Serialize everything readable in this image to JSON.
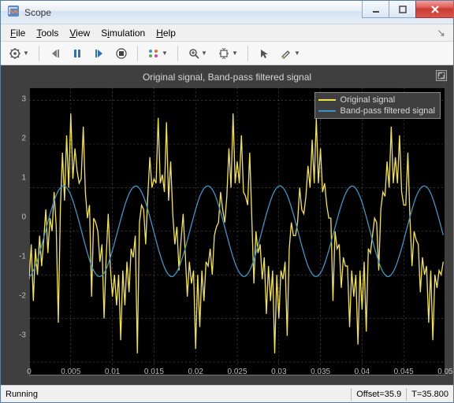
{
  "window": {
    "title": "Scope"
  },
  "menu": {
    "file": "File",
    "tools": "Tools",
    "view": "View",
    "simulation": "Simulation",
    "help": "Help"
  },
  "toolbar": {
    "settings": "Settings",
    "step_back": "Step back",
    "pause": "Pause",
    "step_fwd": "Step forward",
    "stop": "Stop",
    "triggers": "Triggers",
    "zoom": "Zoom",
    "autoscale": "Autoscale",
    "cursor": "Cursor measurements",
    "highlight": "Highlight"
  },
  "plot": {
    "title": "Original signal, Band-pass filtered signal",
    "legend": {
      "s1": "Original signal",
      "s2": "Band-pass filtered signal"
    },
    "yticks": [
      "-3",
      "-2",
      "-1",
      "0",
      "1",
      "2",
      "3"
    ],
    "xticks": [
      "0",
      "0.005",
      "0.01",
      "0.015",
      "0.02",
      "0.025",
      "0.03",
      "0.035",
      "0.04",
      "0.045",
      "0.05"
    ]
  },
  "status": {
    "state": "Running",
    "offset": "Offset=35.9",
    "t": "T=35.800"
  },
  "colors": {
    "s1": "#f2e24b",
    "s2": "#3c93c2",
    "grid": "#5a5a5a",
    "plotbg": "#000000"
  },
  "chart_data": {
    "type": "line",
    "title": "Original signal, Band-pass filtered signal",
    "xlabel": "",
    "ylabel": "",
    "xlim": [
      0,
      0.05
    ],
    "ylim": [
      -3.3,
      3.3
    ],
    "grid": true,
    "legend_position": "upper right",
    "series": [
      {
        "name": "Original signal",
        "color": "#f2e24b",
        "x_step": 0.00025,
        "values": [
          -1.1,
          -0.3,
          -1.6,
          -0.4,
          -1.0,
          -0.1,
          -0.8,
          -0.2,
          0.5,
          -0.5,
          0.3,
          0.0,
          0.9,
          0.1,
          -2.1,
          0.5,
          1.8,
          0.7,
          2.2,
          1.0,
          2.7,
          1.2,
          1.9,
          1.4,
          1.1,
          1.2,
          2.4,
          0.9,
          0.3,
          0.6,
          -1.5,
          0.3,
          0.2,
          0.0,
          -0.7,
          -0.3,
          -2.0,
          -0.6,
          0.4,
          -0.8,
          -1.5,
          -1.0,
          -1.7,
          -1.0,
          -2.5,
          -0.9,
          -1.7,
          -0.7,
          -1.4,
          -0.4,
          -0.6,
          -0.1,
          -2.8,
          0.2,
          0.6,
          0.5,
          -0.3,
          0.8,
          1.7,
          1.0,
          1.2,
          1.1,
          2.6,
          1.1,
          1.3,
          0.9,
          2.5,
          0.7,
          1.6,
          0.4,
          -0.3,
          0.1,
          -0.9,
          -0.2,
          0.4,
          -0.5,
          -1.5,
          -0.7,
          -1.2,
          -0.9,
          -2.7,
          -1.0,
          -2.2,
          -0.9,
          -1.6,
          -0.7,
          -0.8,
          -0.4,
          -1.0,
          -0.1,
          0.1,
          0.2,
          0.9,
          0.5,
          0.2,
          0.8,
          1.9,
          1.0,
          2.7,
          1.1,
          1.6,
          1.1,
          2.2,
          0.9,
          0.8,
          0.6,
          1.8,
          0.3,
          -1.2,
          0.0,
          -0.5,
          -0.3,
          -1.1,
          -0.6,
          -1.9,
          -0.8,
          -1.6,
          -0.9,
          -2.8,
          -1.0,
          -2.0,
          -0.9,
          -1.1,
          -0.7,
          -2.4,
          -0.4,
          0.2,
          -0.1,
          -0.1,
          0.2,
          1.0,
          0.5,
          0.4,
          0.8,
          1.5,
          1.0,
          2.1,
          1.1,
          2.6,
          1.1,
          1.9,
          0.9,
          1.1,
          0.6,
          0.3,
          0.3,
          -1.6,
          0.0,
          -0.4,
          -0.3,
          -1.3,
          -0.6,
          -0.8,
          -0.8,
          -2.2,
          -0.9,
          -1.5,
          -1.0,
          -2.6,
          -0.9,
          -1.8,
          -0.7,
          -2.3,
          -0.4,
          -0.5,
          -0.1,
          0.3,
          0.2,
          -0.9,
          0.5,
          0.9,
          0.8,
          1.6,
          1.0,
          2.4,
          1.1,
          1.7,
          1.1,
          2.2,
          0.9,
          0.6,
          0.6,
          1.8,
          0.3,
          -0.8,
          0.0,
          -0.2,
          -0.3,
          -1.4,
          -0.6,
          -1.0,
          -0.8,
          -2.1,
          -0.9,
          -2.5,
          -1.0,
          -1.3,
          -0.9,
          -1.0,
          -0.7
        ]
      },
      {
        "name": "Band-pass filtered signal",
        "color": "#3c93c2",
        "x_step": 0.00025,
        "values": [
          -1.05,
          -1.0,
          -0.9,
          -0.8,
          -0.66,
          -0.5,
          -0.33,
          -0.15,
          0.03,
          0.21,
          0.39,
          0.55,
          0.7,
          0.83,
          0.93,
          1.0,
          1.04,
          1.04,
          1.0,
          0.93,
          0.83,
          0.7,
          0.55,
          0.39,
          0.21,
          0.03,
          -0.15,
          -0.33,
          -0.5,
          -0.66,
          -0.8,
          -0.9,
          -0.98,
          -1.03,
          -1.04,
          -1.02,
          -0.96,
          -0.87,
          -0.75,
          -0.6,
          -0.44,
          -0.27,
          -0.09,
          0.09,
          0.27,
          0.44,
          0.6,
          0.74,
          0.86,
          0.95,
          1.01,
          1.04,
          1.03,
          0.98,
          0.9,
          0.79,
          0.66,
          0.5,
          0.33,
          0.15,
          -0.03,
          -0.21,
          -0.39,
          -0.55,
          -0.7,
          -0.83,
          -0.93,
          -1.0,
          -1.04,
          -1.04,
          -1.0,
          -0.93,
          -0.83,
          -0.7,
          -0.55,
          -0.39,
          -0.21,
          -0.03,
          0.15,
          0.33,
          0.5,
          0.66,
          0.8,
          0.9,
          0.98,
          1.03,
          1.04,
          1.02,
          0.96,
          0.87,
          0.75,
          0.6,
          0.44,
          0.27,
          0.09,
          -0.09,
          -0.27,
          -0.44,
          -0.6,
          -0.74,
          -0.86,
          -0.95,
          -1.01,
          -1.04,
          -1.03,
          -0.98,
          -0.9,
          -0.79,
          -0.66,
          -0.5,
          -0.33,
          -0.15,
          0.03,
          0.21,
          0.39,
          0.55,
          0.7,
          0.83,
          0.93,
          1.0,
          1.04,
          1.04,
          1.0,
          0.93,
          0.83,
          0.7,
          0.55,
          0.39,
          0.21,
          0.03,
          -0.15,
          -0.33,
          -0.5,
          -0.66,
          -0.8,
          -0.9,
          -0.98,
          -1.03,
          -1.04,
          -1.02,
          -0.96,
          -0.87,
          -0.75,
          -0.6,
          -0.44,
          -0.27,
          -0.09,
          0.09,
          0.27,
          0.44,
          0.6,
          0.74,
          0.86,
          0.95,
          1.01,
          1.04,
          1.03,
          0.98,
          0.9,
          0.79,
          0.66,
          0.5,
          0.33,
          0.15,
          -0.03,
          -0.21,
          -0.39,
          -0.55,
          -0.7,
          -0.83,
          -0.93,
          -1.0,
          -1.04,
          -1.04,
          -1.0,
          -0.93,
          -0.83,
          -0.7,
          -0.55,
          -0.39,
          -0.21,
          -0.03,
          0.15,
          0.33,
          0.5,
          0.66,
          0.8,
          0.9,
          0.98,
          1.03,
          1.04,
          1.02,
          0.96,
          0.87,
          0.75,
          0.6,
          0.44,
          0.27,
          0.09,
          -0.09
        ]
      }
    ]
  }
}
